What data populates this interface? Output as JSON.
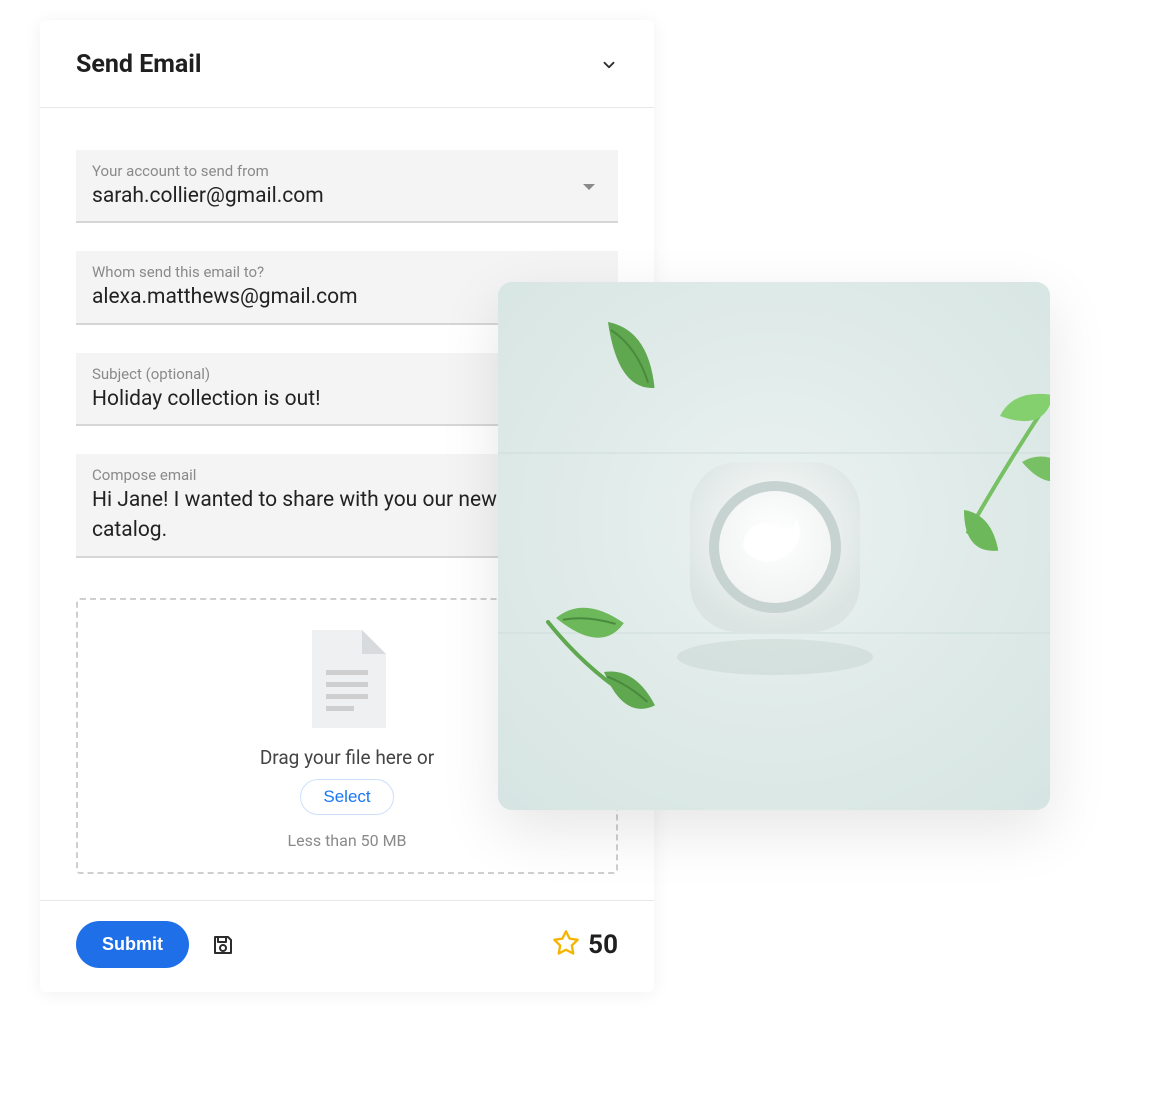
{
  "header": {
    "title": "Send Email"
  },
  "from": {
    "label": "Your account to send from",
    "value": "sarah.collier@gmail.com"
  },
  "to": {
    "label": "Whom send this email to?",
    "value": "alexa.matthews@gmail.com"
  },
  "subject": {
    "label": "Subject (optional)",
    "value": "Holiday collection is out!"
  },
  "compose": {
    "label": "Compose email",
    "value": "Hi Jane! I wanted to share with you our new Spring catalog."
  },
  "drop": {
    "text": "Drag your file here or",
    "select": "Select",
    "limit": "Less than 50 MB"
  },
  "footer": {
    "submit": "Submit",
    "count": "50"
  }
}
